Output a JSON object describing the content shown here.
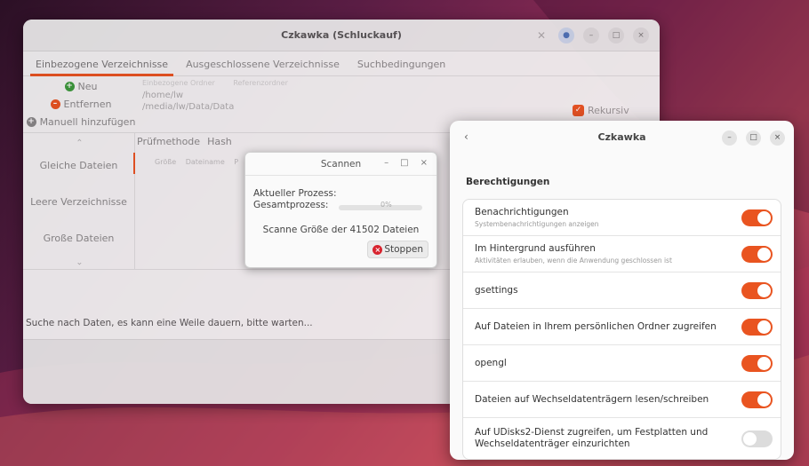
{
  "main_window": {
    "title": "Czkawka (Schluckauf)",
    "tabs": [
      "Einbezogene Verzeichnisse",
      "Ausgeschlossene Verzeichnisse",
      "Suchbedingungen"
    ],
    "buttons": {
      "new": "Neu",
      "remove": "Entfernen",
      "manual_add": "Manuell hinzufügen"
    },
    "dir_header": [
      "Einbezogene Ordner",
      "Referenzordner"
    ],
    "dirs": [
      "/home/lw",
      "/media/lw/Data/Data"
    ],
    "recursive_label": "Rekursiv",
    "side_items": [
      "Gleiche Dateien",
      "Leere Verzeichnisse",
      "Große Dateien"
    ],
    "side_arrow_up": "‹",
    "side_arrow_down": "›",
    "check_tabs": [
      "Prüfmethode",
      "Hash"
    ],
    "columns": [
      "Größe",
      "Dateiname",
      "P"
    ],
    "status": "Suche nach Daten, es kann eine Weile dauern, bitte warten..."
  },
  "scan_dialog": {
    "title": "Scannen",
    "current_process": "Aktueller Prozess:",
    "total_process": "Gesamtprozess:",
    "percent": "0%",
    "progress": 0,
    "message": "Scanne Größe der 41502 Dateien",
    "stop_label": "Stoppen"
  },
  "perm_window": {
    "back": "‹",
    "title": "Czkawka",
    "section": "Berechtigungen",
    "items": [
      {
        "title": "Benachrichtigungen",
        "sub": "Systembenachrichtigungen anzeigen",
        "on": true
      },
      {
        "title": "Im Hintergrund ausführen",
        "sub": "Aktivitäten erlauben, wenn die Anwendung geschlossen ist",
        "on": true
      },
      {
        "title": "gsettings",
        "sub": "",
        "on": true
      },
      {
        "title": "Auf Dateien in Ihrem persönlichen Ordner zugreifen",
        "sub": "",
        "on": true
      },
      {
        "title": "opengl",
        "sub": "",
        "on": true
      },
      {
        "title": "Dateien auf Wechseldatenträgern lesen/schreiben",
        "sub": "",
        "on": true
      },
      {
        "title": "Auf UDisks2-Dienst zugreifen, um Festplatten und Wechseldatenträger einzurichten",
        "sub": "",
        "on": false
      }
    ]
  },
  "colors": {
    "accent": "#e95420",
    "stop": "#d8242f",
    "add": "#3a9a3a"
  }
}
